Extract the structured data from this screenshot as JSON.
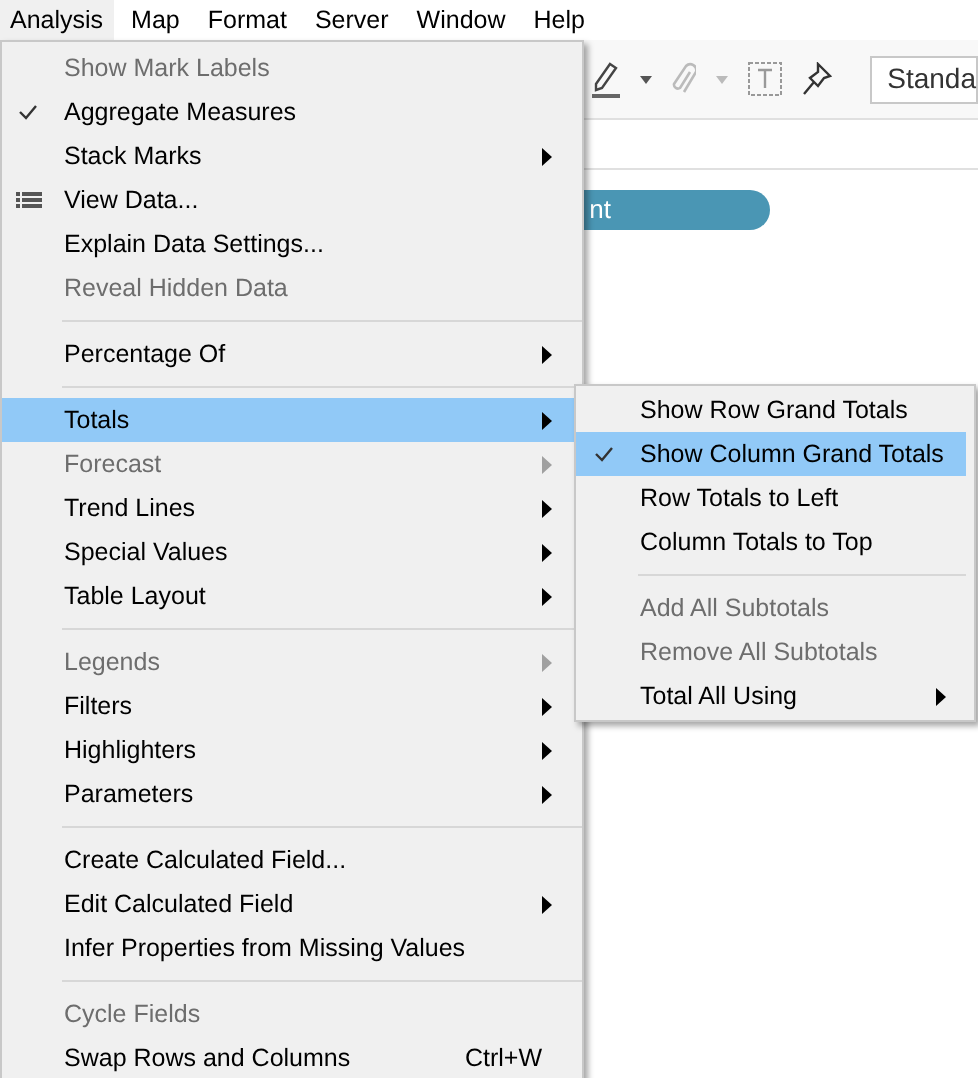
{
  "menubar": [
    {
      "label": "Analysis",
      "selected": true
    },
    {
      "label": "Map",
      "selected": false
    },
    {
      "label": "Format",
      "selected": false
    },
    {
      "label": "Server",
      "selected": false
    },
    {
      "label": "Window",
      "selected": false
    },
    {
      "label": "Help",
      "selected": false
    }
  ],
  "toolbar": {
    "dropdown_value": "Standa"
  },
  "pill": {
    "label": "nt"
  },
  "menu": [
    {
      "kind": "item",
      "label": "Show Mark Labels",
      "disabled": true,
      "checked": false,
      "selected": false,
      "submenu": false
    },
    {
      "kind": "item",
      "label": "Aggregate Measures",
      "disabled": false,
      "checked": true,
      "selected": false,
      "submenu": false
    },
    {
      "kind": "item",
      "label": "Stack Marks",
      "disabled": false,
      "checked": false,
      "selected": false,
      "submenu": true
    },
    {
      "kind": "item",
      "label": "View Data...",
      "disabled": false,
      "checked": false,
      "selected": false,
      "submenu": false,
      "has_icon": true
    },
    {
      "kind": "item",
      "label": "Explain Data Settings...",
      "disabled": false,
      "checked": false,
      "selected": false,
      "submenu": false
    },
    {
      "kind": "item",
      "label": "Reveal Hidden Data",
      "disabled": true,
      "checked": false,
      "selected": false,
      "submenu": false
    },
    {
      "kind": "separator"
    },
    {
      "kind": "item",
      "label": "Percentage Of",
      "disabled": false,
      "checked": false,
      "selected": false,
      "submenu": true
    },
    {
      "kind": "separator"
    },
    {
      "kind": "item",
      "label": "Totals",
      "disabled": false,
      "checked": false,
      "selected": true,
      "submenu": true
    },
    {
      "kind": "item",
      "label": "Forecast",
      "disabled": true,
      "checked": false,
      "selected": false,
      "submenu": true
    },
    {
      "kind": "item",
      "label": "Trend Lines",
      "disabled": false,
      "checked": false,
      "selected": false,
      "submenu": true
    },
    {
      "kind": "item",
      "label": "Special Values",
      "disabled": false,
      "checked": false,
      "selected": false,
      "submenu": true
    },
    {
      "kind": "item",
      "label": "Table Layout",
      "disabled": false,
      "checked": false,
      "selected": false,
      "submenu": true
    },
    {
      "kind": "separator"
    },
    {
      "kind": "item",
      "label": "Legends",
      "disabled": true,
      "checked": false,
      "selected": false,
      "submenu": true
    },
    {
      "kind": "item",
      "label": "Filters",
      "disabled": false,
      "checked": false,
      "selected": false,
      "submenu": true
    },
    {
      "kind": "item",
      "label": "Highlighters",
      "disabled": false,
      "checked": false,
      "selected": false,
      "submenu": true
    },
    {
      "kind": "item",
      "label": "Parameters",
      "disabled": false,
      "checked": false,
      "selected": false,
      "submenu": true
    },
    {
      "kind": "separator"
    },
    {
      "kind": "item",
      "label": "Create Calculated Field...",
      "disabled": false,
      "checked": false,
      "selected": false,
      "submenu": false
    },
    {
      "kind": "item",
      "label": "Edit Calculated Field",
      "disabled": false,
      "checked": false,
      "selected": false,
      "submenu": true
    },
    {
      "kind": "item",
      "label": "Infer Properties from Missing Values",
      "disabled": false,
      "checked": false,
      "selected": false,
      "submenu": false
    },
    {
      "kind": "separator"
    },
    {
      "kind": "item",
      "label": "Cycle Fields",
      "disabled": true,
      "checked": false,
      "selected": false,
      "submenu": false
    },
    {
      "kind": "item",
      "label": "Swap Rows and Columns",
      "disabled": false,
      "checked": false,
      "selected": false,
      "submenu": false,
      "shortcut": "Ctrl+W"
    }
  ],
  "submenu": [
    {
      "kind": "item",
      "label": "Show Row Grand Totals",
      "disabled": false,
      "checked": false,
      "selected": false,
      "submenu": false
    },
    {
      "kind": "item",
      "label": "Show Column Grand Totals",
      "disabled": false,
      "checked": true,
      "selected": true,
      "submenu": false
    },
    {
      "kind": "item",
      "label": "Row Totals to Left",
      "disabled": false,
      "checked": false,
      "selected": false,
      "submenu": false
    },
    {
      "kind": "item",
      "label": "Column Totals to Top",
      "disabled": false,
      "checked": false,
      "selected": false,
      "submenu": false
    },
    {
      "kind": "separator"
    },
    {
      "kind": "item",
      "label": "Add All Subtotals",
      "disabled": true,
      "checked": false,
      "selected": false,
      "submenu": false
    },
    {
      "kind": "item",
      "label": "Remove All Subtotals",
      "disabled": true,
      "checked": false,
      "selected": false,
      "submenu": false
    },
    {
      "kind": "item",
      "label": "Total All Using",
      "disabled": false,
      "checked": false,
      "selected": false,
      "submenu": true
    }
  ]
}
